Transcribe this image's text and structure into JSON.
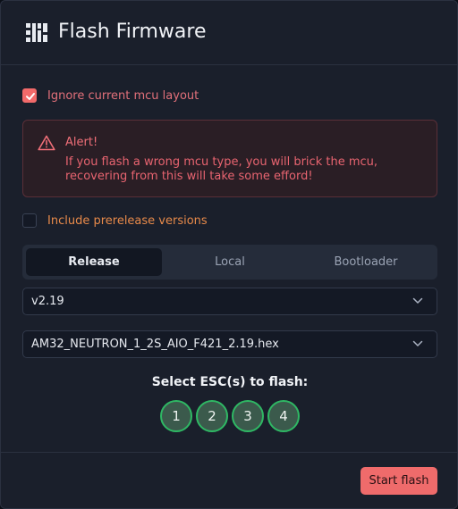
{
  "dialog": {
    "title": "Flash Firmware",
    "logo_icon": "grid-logo-icon"
  },
  "options": {
    "ignore_layout": {
      "label": "Ignore current mcu layout",
      "checked": true
    },
    "include_prerelease": {
      "label": "Include prerelease versions",
      "checked": false
    }
  },
  "alert": {
    "icon": "warning-triangle-icon",
    "title": "Alert!",
    "message": "If you flash a wrong mcu type, you will brick the mcu, recovering from this will take some efford!"
  },
  "tabs": [
    {
      "label": "Release",
      "active": true
    },
    {
      "label": "Local",
      "active": false
    },
    {
      "label": "Bootloader",
      "active": false
    }
  ],
  "version_select": {
    "value": "v2.19"
  },
  "file_select": {
    "value": "AM32_NEUTRON_1_2S_AIO_F421_2.19.hex"
  },
  "esc_select": {
    "title": "Select ESC(s) to flash:",
    "escs": [
      "1",
      "2",
      "3",
      "4"
    ]
  },
  "footer": {
    "start_label": "Start flash"
  },
  "colors": {
    "accent": "#ef6b6b",
    "esc_border": "#2fb864",
    "warning_text": "#e2707a",
    "prerelease_text": "#e88a4a"
  }
}
